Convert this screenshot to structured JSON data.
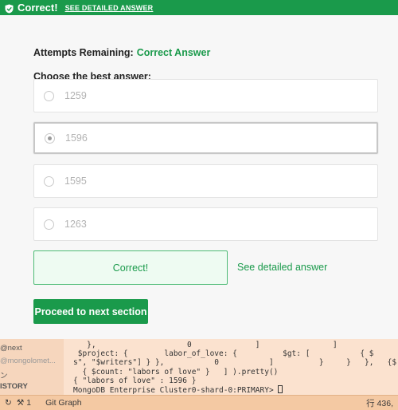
{
  "banner": {
    "title": "Correct!",
    "detail_link": "SEE DETAILED ANSWER",
    "color": "#1a9a4b"
  },
  "quiz": {
    "attempts_label": "Attempts Remaining:",
    "attempts_value": "Correct Answer",
    "question": "Choose the best answer:",
    "options": [
      {
        "label": "1259",
        "selected": false
      },
      {
        "label": "1596",
        "selected": true
      },
      {
        "label": "1595",
        "selected": false
      },
      {
        "label": "1263",
        "selected": false
      }
    ],
    "result_text": "Correct!",
    "detail_link": "See detailed answer",
    "proceed_label": "Proceed to next section"
  },
  "terminal": {
    "sidebar": [
      "@next",
      "@mongolomet...",
      "ン",
      "ISTORY"
    ],
    "lines": [
      "   },                    0              ]                ]",
      " $project: {        labor_of_love: {          $gt: [           { $",
      "s\", \"$writers\"] } },           0           ]          }     }   },   {$",
      "  { $count: \"labors of love\" }   ] ).pretty()",
      "{ \"labors of love\" : 1596 }",
      "MongoDB Enterprise Cluster0-shard-0:PRIMARY> "
    ]
  },
  "statusbar": {
    "sync": "↻",
    "branch_count": "1",
    "git_graph": "Git Graph",
    "line_info": "行 436,"
  }
}
